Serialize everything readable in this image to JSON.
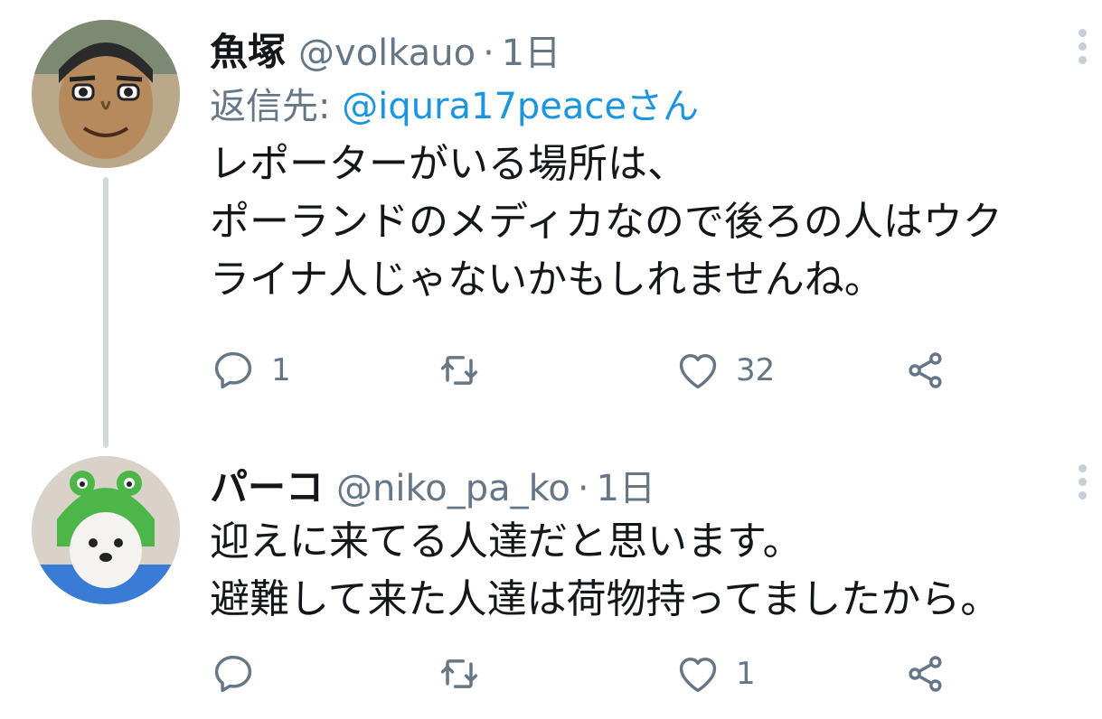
{
  "tweets": [
    {
      "display_name": "魚塚",
      "handle": "@volkauo",
      "separator": "·",
      "time": "1日",
      "reply_prefix": "返信先: ",
      "reply_to": "@iqura17peaceさん",
      "lines": [
        "レポーターがいる場所は、",
        "ポーランドのメディカなので後ろの人はウク",
        "ライナ人じゃないかもしれませんね。"
      ],
      "reply_count": "1",
      "retweet_count": "",
      "like_count": "32",
      "avatar_icon": "cartoon-man-avatar"
    },
    {
      "display_name": "パーコ",
      "handle": "@niko_pa_ko",
      "separator": "·",
      "time": "1日",
      "lines": [
        "迎えに来てる人達だと思います。",
        "避難して来た人達は荷物持ってましたから。"
      ],
      "reply_count": "",
      "retweet_count": "",
      "like_count": "1",
      "avatar_icon": "dog-frog-hat-avatar"
    }
  ],
  "colors": {
    "text": "#14171a",
    "secondary": "#657786",
    "link": "#1b95e0",
    "thread_line": "#cfd9de"
  },
  "icons": [
    "reply-icon",
    "retweet-icon",
    "like-icon",
    "share-icon",
    "more-options-icon"
  ]
}
